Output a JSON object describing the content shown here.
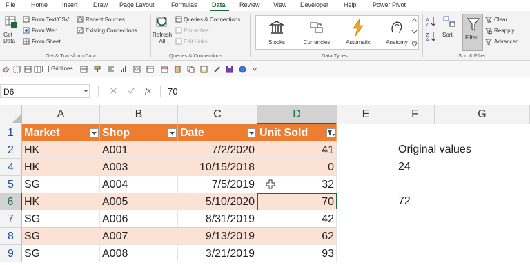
{
  "ribbon_tabs": [
    "File",
    "Home",
    "Insert",
    "Draw",
    "Page Layout",
    "Formulas",
    "Data",
    "Review",
    "View",
    "Developer",
    "Help",
    "Power Pivot"
  ],
  "active_tab": "Data",
  "get_transform": {
    "get_data_label": "Get Data",
    "from_text_csv": "From Text/CSV",
    "from_web": "From Web",
    "from_sheet": "From Sheet",
    "recent_sources": "Recent Sources",
    "existing_connections": "Existing Connections",
    "caption": "Get & Transform Data"
  },
  "queries": {
    "refresh_all": "Refresh All",
    "queries_connections": "Queries & Connections",
    "properties": "Properties",
    "edit_links": "Edit Links",
    "caption": "Queries & Connections"
  },
  "data_types": {
    "items": [
      "Stocks",
      "Currencies",
      "Automatic",
      "Anatomy"
    ],
    "caption": "Data Types"
  },
  "sort_filter": {
    "sort_label": "Sort",
    "filter_label": "Filter",
    "clear_label": "Clear",
    "reapply_label": "Reapply",
    "advanced_label": "Advanced",
    "caption": "Sort & Filter"
  },
  "qat": {
    "gridlines_label": "Gridlines"
  },
  "formula_bar": {
    "name_box": "D6",
    "formula": "70"
  },
  "sheet": {
    "columns": [
      "A",
      "B",
      "C",
      "D",
      "E",
      "F",
      "G"
    ],
    "selected_column": "D",
    "header_row_number": "1",
    "headers": [
      "Market",
      "Shop",
      "Date",
      "Unit Sold"
    ],
    "rows": [
      {
        "num": "2",
        "market": "HK",
        "shop": "A001",
        "date": "7/2/2020",
        "units": "41",
        "band": true
      },
      {
        "num": "4",
        "market": "HK",
        "shop": "A003",
        "date": "10/15/2018",
        "units": "0",
        "band": true
      },
      {
        "num": "5",
        "market": "SG",
        "shop": "A004",
        "date": "7/5/2019",
        "units": "32",
        "band": false
      },
      {
        "num": "6",
        "market": "HK",
        "shop": "A005",
        "date": "5/10/2020",
        "units": "70",
        "band": true
      },
      {
        "num": "7",
        "market": "SG",
        "shop": "A006",
        "date": "8/31/2019",
        "units": "42",
        "band": false
      },
      {
        "num": "8",
        "market": "SG",
        "shop": "A007",
        "date": "9/13/2019",
        "units": "62",
        "band": true
      },
      {
        "num": "9",
        "market": "SG",
        "shop": "A008",
        "date": "3/21/2019",
        "units": "93",
        "band": false
      }
    ],
    "selected_row": "6",
    "side_label": "Original values",
    "side_value_1": "24",
    "side_value_2": "72"
  },
  "colors": {
    "accent": "#1d6b3d",
    "table_header": "#ed7d31",
    "band_fill": "#fbe2d5",
    "row_number": "#1f4e9c"
  }
}
